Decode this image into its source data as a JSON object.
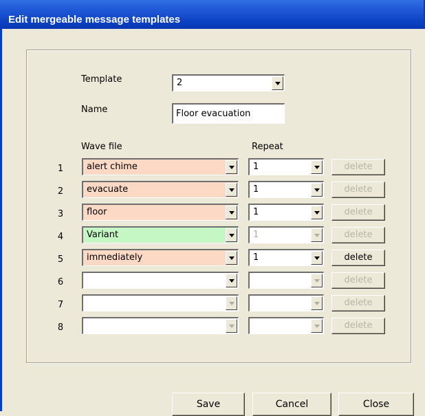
{
  "window": {
    "title": "Edit mergeable message templates"
  },
  "form": {
    "template_label": "Template",
    "template_value": "2",
    "name_label": "Name",
    "name_value": "Floor evacuation",
    "wave_file_header": "Wave file",
    "repeat_header": "Repeat"
  },
  "rows": [
    {
      "num": "1",
      "wave": "alert chime",
      "repeat": "1",
      "delete_label": "delete",
      "wave_color": "orange",
      "repeat_enabled": true,
      "delete_enabled": false
    },
    {
      "num": "2",
      "wave": "evacuate",
      "repeat": "1",
      "delete_label": "delete",
      "wave_color": "orange",
      "repeat_enabled": true,
      "delete_enabled": false
    },
    {
      "num": "3",
      "wave": "floor",
      "repeat": "1",
      "delete_label": "delete",
      "wave_color": "orange",
      "repeat_enabled": true,
      "delete_enabled": false
    },
    {
      "num": "4",
      "wave": "Variant",
      "repeat": "1",
      "delete_label": "delete",
      "wave_color": "green",
      "repeat_enabled": false,
      "delete_enabled": false
    },
    {
      "num": "5",
      "wave": "immediately",
      "repeat": "1",
      "delete_label": "delete",
      "wave_color": "orange",
      "repeat_enabled": true,
      "delete_enabled": true
    },
    {
      "num": "6",
      "wave": "",
      "repeat": "",
      "delete_label": "delete",
      "wave_color": "white",
      "repeat_enabled": false,
      "delete_enabled": false
    },
    {
      "num": "7",
      "wave": "",
      "repeat": "",
      "delete_label": "delete",
      "wave_color": "white",
      "repeat_enabled": false,
      "delete_enabled": false
    },
    {
      "num": "8",
      "wave": "",
      "repeat": "",
      "delete_label": "delete",
      "wave_color": "white",
      "repeat_enabled": false,
      "delete_enabled": false
    }
  ],
  "buttons": {
    "save": "Save",
    "cancel": "Cancel",
    "close": "Close"
  },
  "colors": {
    "orange_field": "#fcd9c5",
    "green_field": "#c4f7c4",
    "title_bar": "#0a3fc0",
    "dialog_bg": "#ece9d8"
  }
}
